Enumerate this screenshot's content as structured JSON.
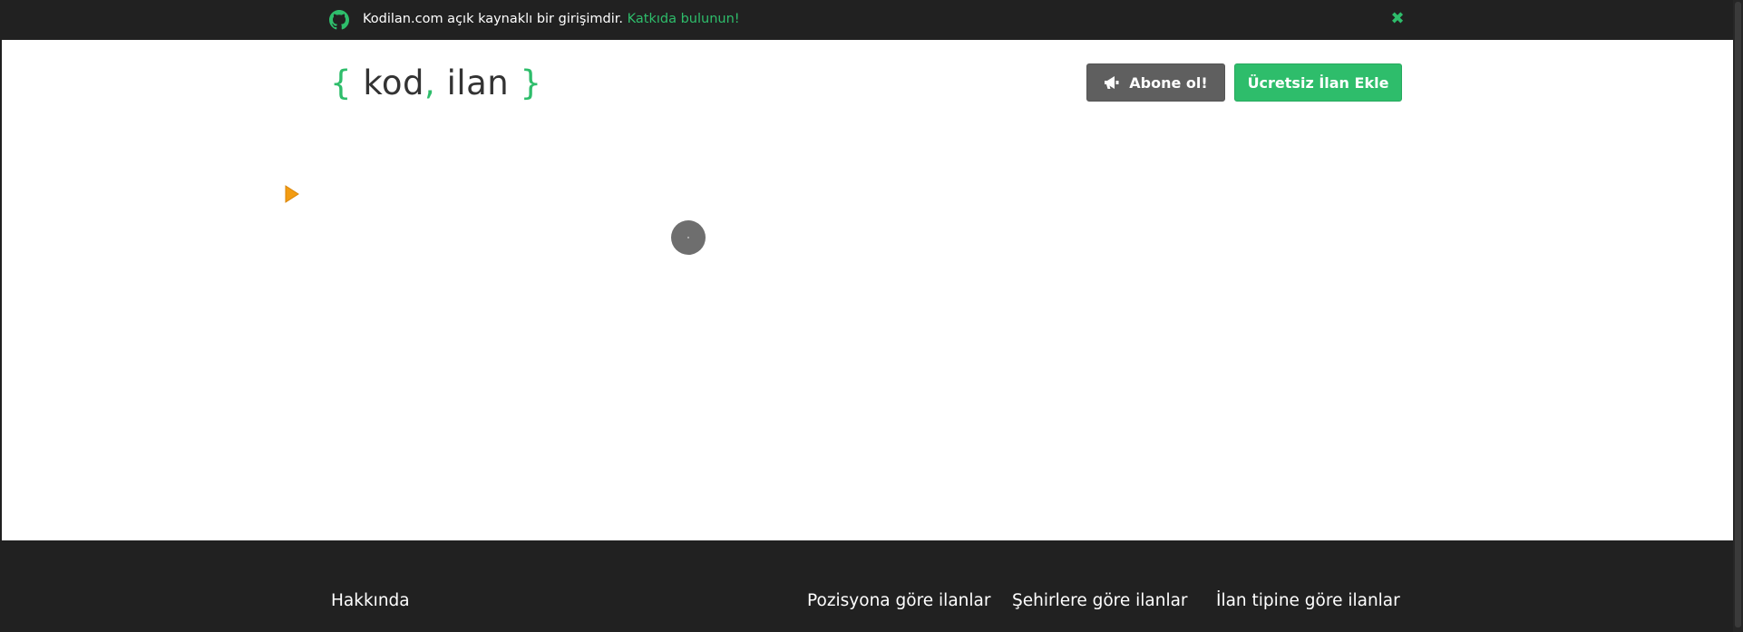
{
  "topbar": {
    "icon": "github-icon",
    "notice_text": "Kodilan.com açık kaynaklı bir girişimdir.",
    "notice_link": "Katkıda bulunun!",
    "close_icon": "close-icon"
  },
  "header": {
    "logo": {
      "open_brace": "{",
      "word1": "kod",
      "comma": ",",
      "word2": "ilan",
      "close_brace": "}"
    },
    "subscribe_button": {
      "icon": "megaphone-icon",
      "label": "Abone ol!"
    },
    "add_listing_button": {
      "label": "Ücretsiz İlan Ekle"
    }
  },
  "footer": {
    "about": "Hakkında",
    "by_position": "Pozisyona göre ilanlar",
    "by_city": "Şehirlere göre ilanlar",
    "by_type": "İlan tipine göre ilanlar"
  },
  "colors": {
    "accent": "#2ebd6b",
    "dark_bar": "#212121",
    "secondary_button": "#5f5f5f"
  }
}
